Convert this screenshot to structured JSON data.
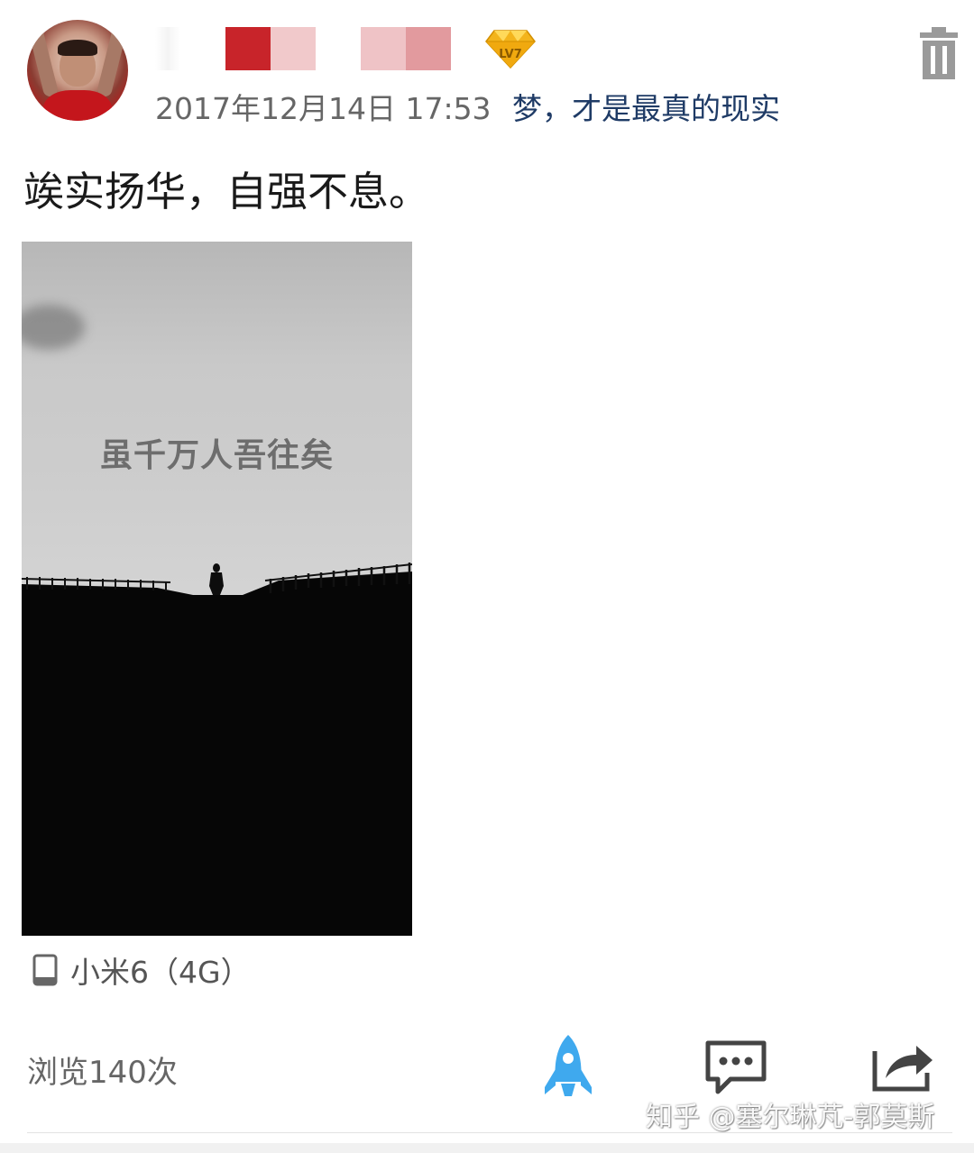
{
  "post": {
    "time": "2017年12月14日 17:53",
    "signature": "梦，才是最真的现实",
    "text": "竢实扬华，自强不息。",
    "image_caption": "虽千万人吾往矣",
    "device": "小米6（4G）",
    "views": "浏览140次"
  },
  "user": {
    "level": "LV7"
  },
  "icons": {
    "delete": "trash-icon",
    "device": "phone-icon",
    "like": "rocket-icon",
    "comment": "comment-icon",
    "share": "share-icon",
    "level": "diamond-icon"
  },
  "colors": {
    "signature": "#1f3b66",
    "rocket": "#3fa9ee",
    "level_badge": "#f3b41c",
    "icon_gray": "#555555"
  },
  "watermark": "知乎 @塞尔琳芃-郭莫斯"
}
